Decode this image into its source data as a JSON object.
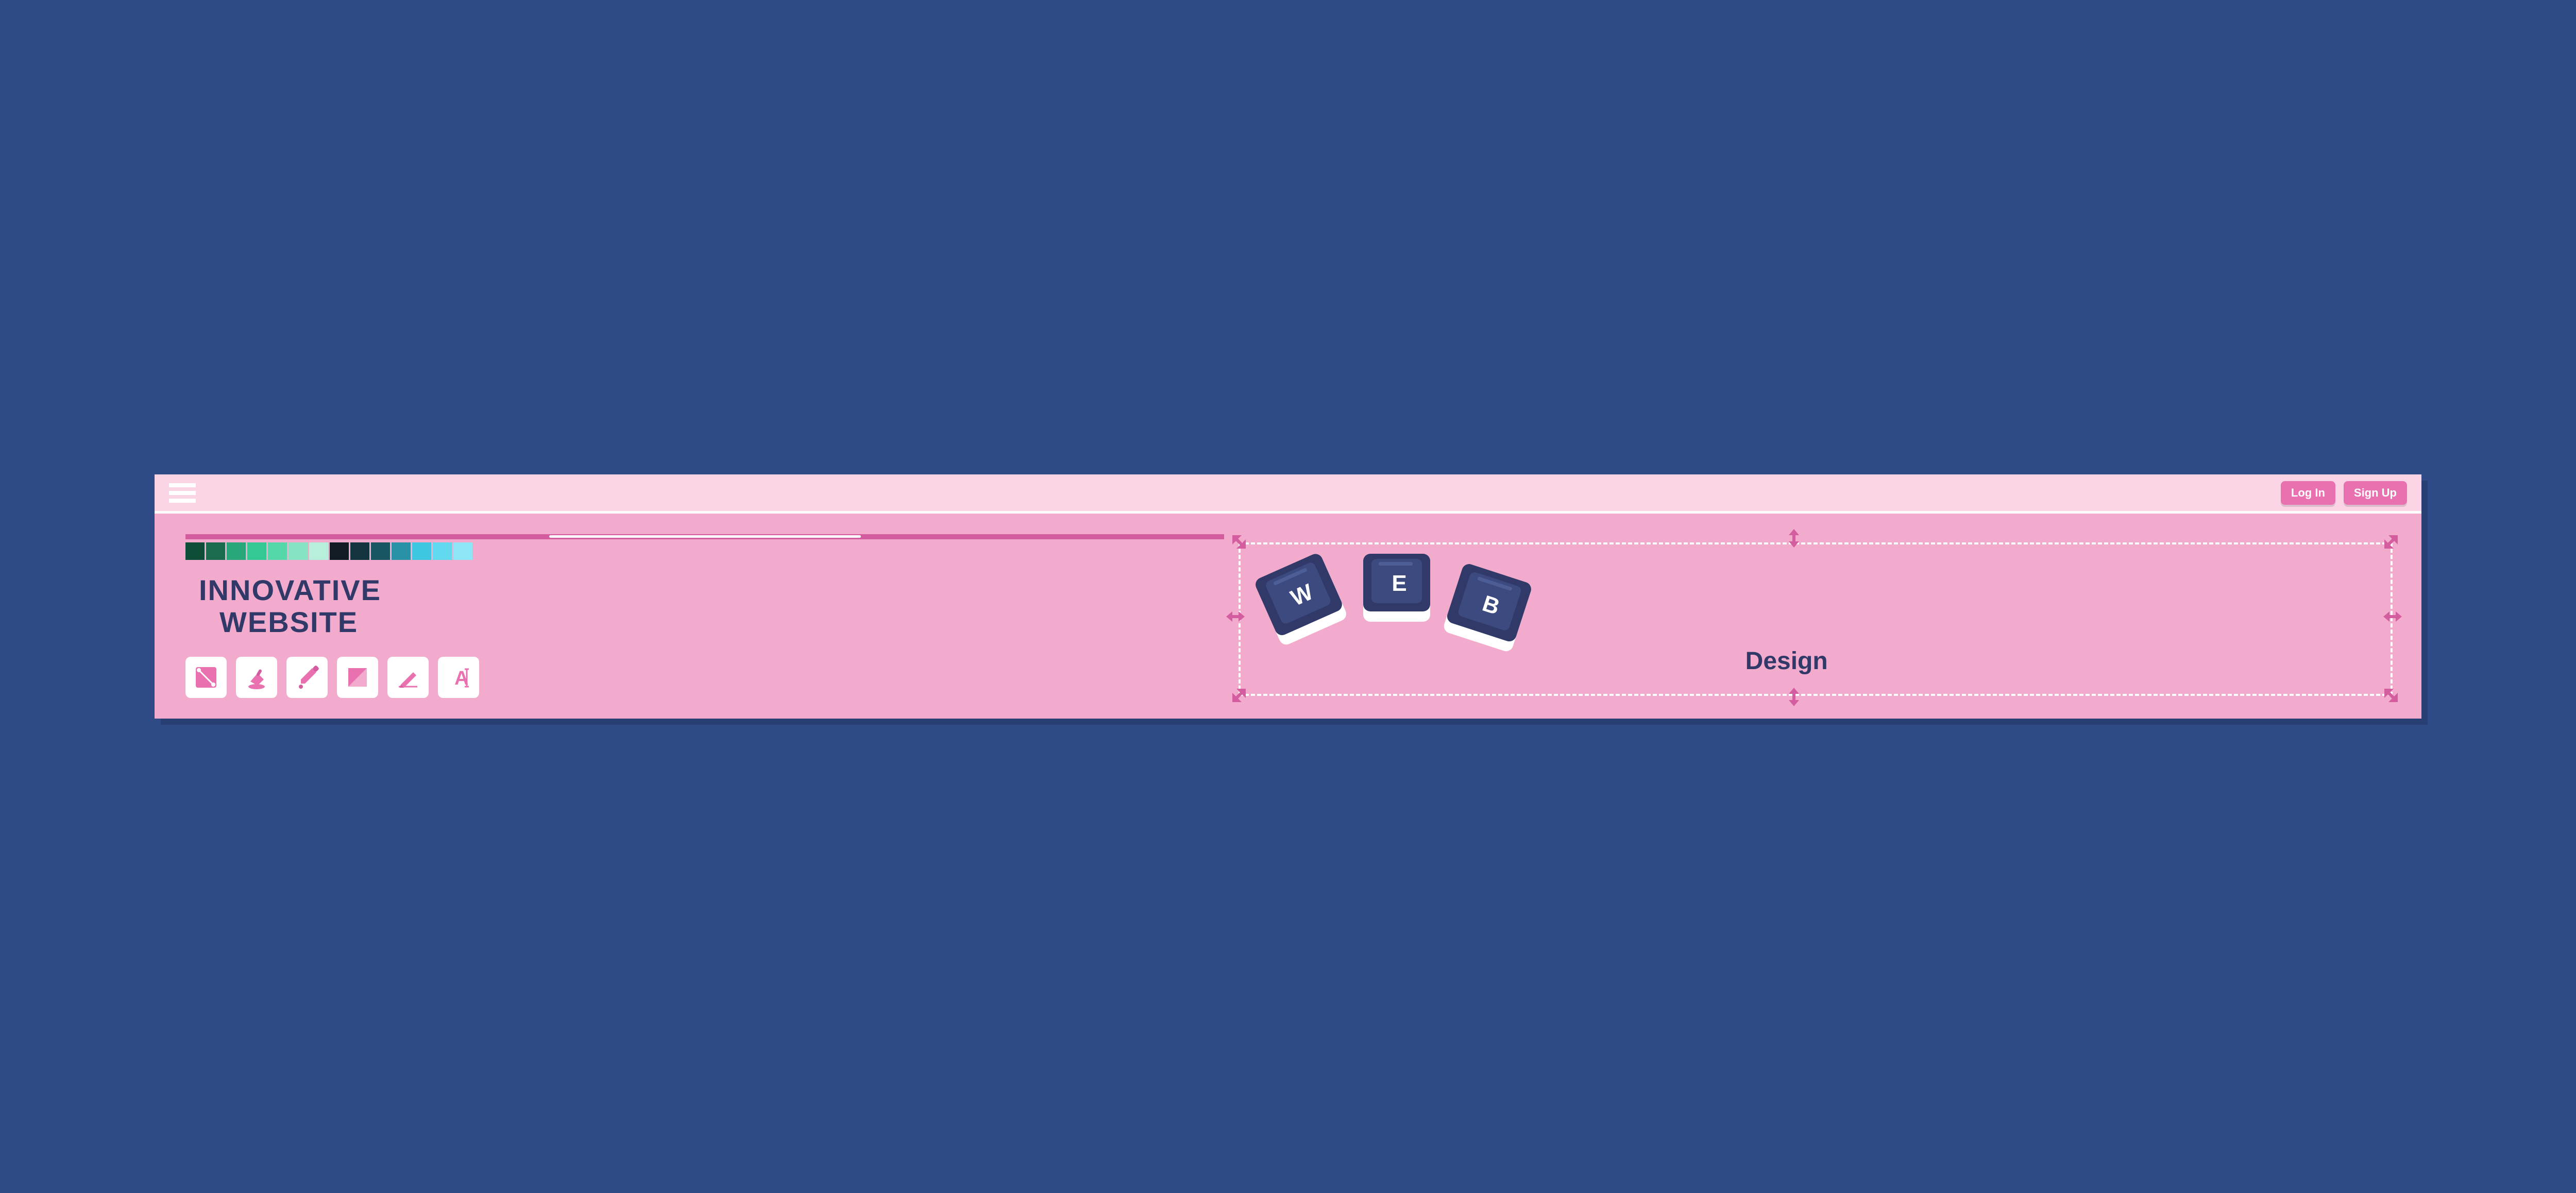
{
  "colors": {
    "bg": "#2e4a87",
    "window": "#f3abcd",
    "titlebar": "#fbd5e6",
    "accent": "#e971b0",
    "darknavy": "#303968",
    "arrow": "#d35d9f"
  },
  "header": {
    "login_label": "Log In",
    "signup_label": "Sign Up"
  },
  "palette": [
    "#0d4d37",
    "#1b6b4f",
    "#28a77a",
    "#33c894",
    "#54d8aa",
    "#86e3c3",
    "#b7efdc",
    "#121c23",
    "#14353f",
    "#1a5562",
    "#2a92a7",
    "#3dc7e0",
    "#61d9ef",
    "#8ee6f6"
  ],
  "headline_line1": "INNOVATIVE",
  "headline_line2": "WEBSITE",
  "tools": [
    {
      "name": "shape-tool-icon"
    },
    {
      "name": "paint-bucket-icon"
    },
    {
      "name": "eyedropper-icon"
    },
    {
      "name": "gradient-icon"
    },
    {
      "name": "pencil-icon"
    },
    {
      "name": "type-tool-icon"
    }
  ],
  "keycaps": {
    "w": "W",
    "e": "E",
    "b": "B"
  },
  "design_label": "Design"
}
